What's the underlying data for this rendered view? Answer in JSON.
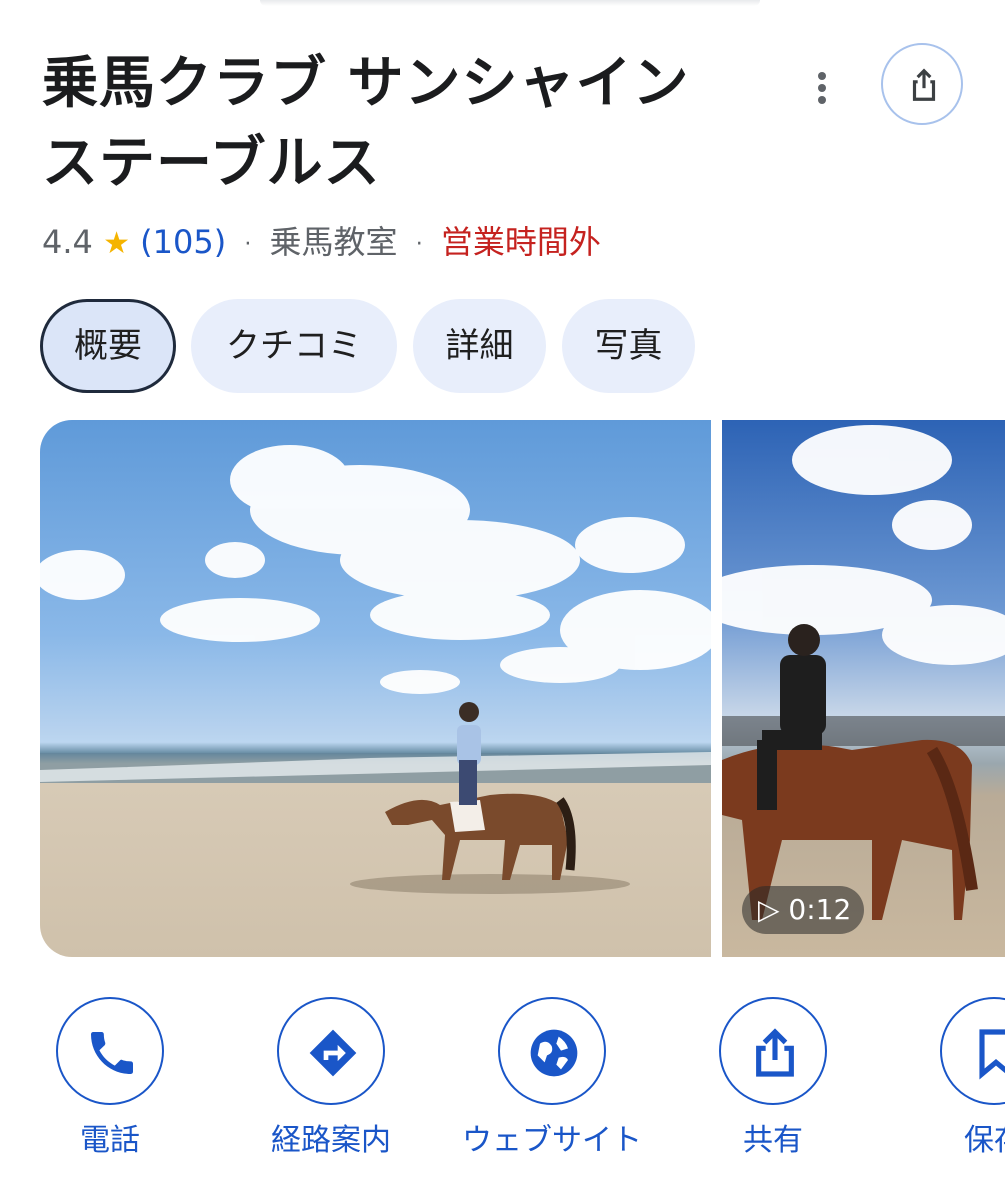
{
  "place": {
    "title_line1": "乗馬クラブ サンシャイン",
    "title_line2": "ステーブルス",
    "rating": "4.4",
    "review_count": "(105)",
    "category": "乗馬教室",
    "status": "営業時間外",
    "star_glyph": "★",
    "separator": "·"
  },
  "tabs": [
    {
      "label": "概要",
      "selected": true
    },
    {
      "label": "クチコミ",
      "selected": false
    },
    {
      "label": "詳細",
      "selected": false
    },
    {
      "label": "写真",
      "selected": false
    }
  ],
  "photos": {
    "video_duration": "▷ 0:12"
  },
  "actions": [
    {
      "label": "電話",
      "icon": "phone-icon"
    },
    {
      "label": "経路案内",
      "icon": "directions-icon"
    },
    {
      "label": "ウェブサイト",
      "icon": "globe-icon"
    },
    {
      "label": "共有",
      "icon": "share-icon"
    },
    {
      "label": "保存",
      "icon": "bookmark-icon"
    }
  ],
  "colors": {
    "accent": "#1a56c8",
    "closed_status": "#c5221f",
    "star": "#f5b400",
    "chip_bg": "#e8eefb"
  }
}
